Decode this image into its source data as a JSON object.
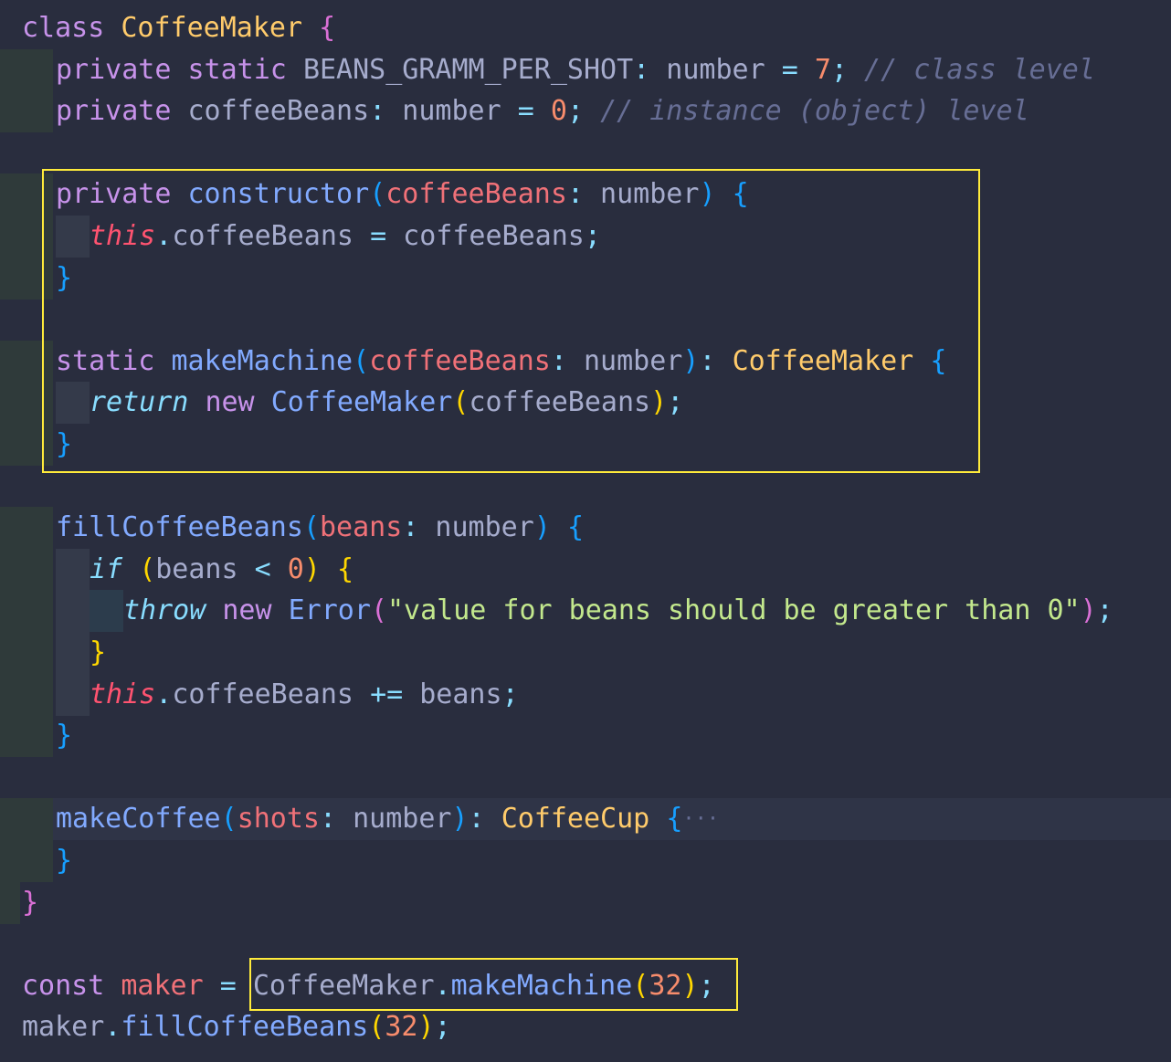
{
  "editor": {
    "language": "typescript",
    "colors": {
      "background": "#292d3e",
      "highlight_box": "#ffeb3b",
      "current_line": "#2f3447"
    },
    "lines": [
      {
        "tokens": [
          [
            "k-keyword",
            "class"
          ],
          [
            "k-plain",
            " "
          ],
          [
            "k-class",
            "CoffeeMaker"
          ],
          [
            "k-plain",
            " "
          ],
          [
            "k-b2",
            "{"
          ]
        ]
      },
      {
        "tokens": [
          [
            "k-keyword",
            "private"
          ],
          [
            "k-plain",
            " "
          ],
          [
            "k-keyword",
            "static"
          ],
          [
            "k-plain",
            " "
          ],
          [
            "k-prop",
            "BEANS_GRAMM_PER_SHOT"
          ],
          [
            "k-punct",
            ":"
          ],
          [
            "k-plain",
            " number "
          ],
          [
            "k-punct",
            "="
          ],
          [
            "k-plain",
            " "
          ],
          [
            "k-number",
            "7"
          ],
          [
            "k-punct",
            ";"
          ],
          [
            "k-plain",
            " "
          ],
          [
            "k-comment",
            "// class level"
          ]
        ]
      },
      {
        "tokens": [
          [
            "k-keyword",
            "private"
          ],
          [
            "k-plain",
            " "
          ],
          [
            "k-prop",
            "coffeeBeans"
          ],
          [
            "k-punct",
            ":"
          ],
          [
            "k-plain",
            " number "
          ],
          [
            "k-punct",
            "="
          ],
          [
            "k-plain",
            " "
          ],
          [
            "k-number",
            "0"
          ],
          [
            "k-punct",
            ";"
          ],
          [
            "k-plain",
            " "
          ],
          [
            "k-comment",
            "// instance (object) level"
          ]
        ]
      },
      {
        "tokens": []
      },
      {
        "tokens": [
          [
            "k-keyword",
            "private"
          ],
          [
            "k-plain",
            " "
          ],
          [
            "k-func",
            "constructor"
          ],
          [
            "k-b3",
            "("
          ],
          [
            "k-param",
            "coffeeBeans"
          ],
          [
            "k-punct",
            ":"
          ],
          [
            "k-plain",
            " number"
          ],
          [
            "k-b3",
            ")"
          ],
          [
            "k-plain",
            " "
          ],
          [
            "k-b3",
            "{"
          ]
        ]
      },
      {
        "tokens": [
          [
            "k-this",
            "this"
          ],
          [
            "k-punct",
            "."
          ],
          [
            "k-prop",
            "coffeeBeans"
          ],
          [
            "k-plain",
            " "
          ],
          [
            "k-punct",
            "="
          ],
          [
            "k-plain",
            " coffeeBeans"
          ],
          [
            "k-punct",
            ";"
          ]
        ]
      },
      {
        "tokens": [
          [
            "k-b3",
            "}"
          ]
        ]
      },
      {
        "tokens": []
      },
      {
        "tokens": [
          [
            "k-keyword",
            "static"
          ],
          [
            "k-plain",
            " "
          ],
          [
            "k-func",
            "makeMachine"
          ],
          [
            "k-b3",
            "("
          ],
          [
            "k-param",
            "coffeeBeans"
          ],
          [
            "k-punct",
            ":"
          ],
          [
            "k-plain",
            " number"
          ],
          [
            "k-b3",
            ")"
          ],
          [
            "k-punct",
            ":"
          ],
          [
            "k-plain",
            " "
          ],
          [
            "k-class",
            "CoffeeMaker"
          ],
          [
            "k-plain",
            " "
          ],
          [
            "k-b3",
            "{"
          ]
        ]
      },
      {
        "tokens": [
          [
            "k-control",
            "return"
          ],
          [
            "k-plain",
            " "
          ],
          [
            "k-keyword",
            "new"
          ],
          [
            "k-plain",
            " "
          ],
          [
            "k-func",
            "CoffeeMaker"
          ],
          [
            "k-b1",
            "("
          ],
          [
            "k-plain",
            "coffeeBeans"
          ],
          [
            "k-b1",
            ")"
          ],
          [
            "k-punct",
            ";"
          ]
        ]
      },
      {
        "tokens": [
          [
            "k-b3",
            "}"
          ]
        ]
      },
      {
        "tokens": []
      },
      {
        "tokens": [
          [
            "k-func",
            "fillCoffeeBeans"
          ],
          [
            "k-b3",
            "("
          ],
          [
            "k-param",
            "beans"
          ],
          [
            "k-punct",
            ":"
          ],
          [
            "k-plain",
            " number"
          ],
          [
            "k-b3",
            ")"
          ],
          [
            "k-plain",
            " "
          ],
          [
            "k-b3",
            "{"
          ]
        ]
      },
      {
        "tokens": [
          [
            "k-control",
            "if"
          ],
          [
            "k-plain",
            " "
          ],
          [
            "k-b1",
            "("
          ],
          [
            "k-plain",
            "beans "
          ],
          [
            "k-punct",
            "<"
          ],
          [
            "k-plain",
            " "
          ],
          [
            "k-number",
            "0"
          ],
          [
            "k-b1",
            ")"
          ],
          [
            "k-plain",
            " "
          ],
          [
            "k-b1",
            "{"
          ]
        ]
      },
      {
        "tokens": [
          [
            "k-control",
            "throw"
          ],
          [
            "k-plain",
            " "
          ],
          [
            "k-keyword",
            "new"
          ],
          [
            "k-plain",
            " "
          ],
          [
            "k-func",
            "Error"
          ],
          [
            "k-b2",
            "("
          ],
          [
            "k-string",
            "\"value for beans should be greater than 0\""
          ],
          [
            "k-b2",
            ")"
          ],
          [
            "k-punct",
            ";"
          ]
        ]
      },
      {
        "tokens": [
          [
            "k-b1",
            "}"
          ]
        ]
      },
      {
        "tokens": [
          [
            "k-this",
            "this"
          ],
          [
            "k-punct",
            "."
          ],
          [
            "k-prop",
            "coffeeBeans"
          ],
          [
            "k-plain",
            " "
          ],
          [
            "k-punct",
            "+="
          ],
          [
            "k-plain",
            " beans"
          ],
          [
            "k-punct",
            ";"
          ]
        ]
      },
      {
        "tokens": [
          [
            "k-b3",
            "}"
          ]
        ]
      },
      {
        "tokens": []
      },
      {
        "tokens": [
          [
            "k-func",
            "makeCoffee"
          ],
          [
            "k-b3",
            "("
          ],
          [
            "k-param",
            "shots"
          ],
          [
            "k-punct",
            ":"
          ],
          [
            "k-plain",
            " number"
          ],
          [
            "k-b3",
            ")"
          ],
          [
            "k-punct",
            ":"
          ],
          [
            "k-plain",
            " "
          ],
          [
            "k-class",
            "CoffeeCup"
          ],
          [
            "k-plain",
            " "
          ],
          [
            "k-b3",
            "{"
          ]
        ],
        "folded": true,
        "fold_marker": "···"
      },
      {
        "tokens": [
          [
            "k-b3",
            "}"
          ]
        ]
      },
      {
        "tokens": [
          [
            "k-b2",
            "}"
          ]
        ]
      },
      {
        "tokens": []
      },
      {
        "tokens": [
          [
            "k-keyword",
            "const"
          ],
          [
            "k-plain",
            " "
          ],
          [
            "k-param",
            "maker"
          ],
          [
            "k-plain",
            " "
          ],
          [
            "k-punct",
            "="
          ],
          [
            "k-plain",
            " CoffeeMaker"
          ],
          [
            "k-punct",
            "."
          ],
          [
            "k-func",
            "makeMachine"
          ],
          [
            "k-b1",
            "("
          ],
          [
            "k-number",
            "32"
          ],
          [
            "k-b1",
            ")"
          ],
          [
            "k-punct",
            ";"
          ]
        ]
      },
      {
        "tokens": [
          [
            "k-plain",
            "maker"
          ],
          [
            "k-punct",
            "."
          ],
          [
            "k-func",
            "fillCoffeeBeans"
          ],
          [
            "k-b1",
            "("
          ],
          [
            "k-number",
            "32"
          ],
          [
            "k-b1",
            ")"
          ],
          [
            "k-punct",
            ";"
          ]
        ]
      }
    ]
  }
}
